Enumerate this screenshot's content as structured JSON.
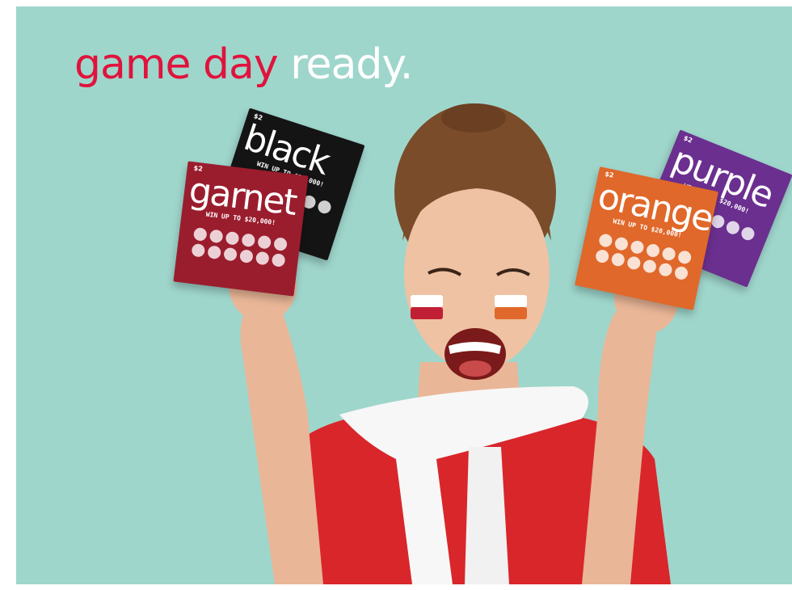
{
  "headline": {
    "part1": "game day",
    "part2": "ready."
  },
  "tickets": [
    {
      "word": "black",
      "price": "$2",
      "win": "WIN UP TO $20,000!",
      "color": "#141414"
    },
    {
      "word": "garnet",
      "price": "$2",
      "win": "WIN UP TO $20,000!",
      "color": "#9a1d2e"
    },
    {
      "word": "purple",
      "price": "$2",
      "win": "WIN UP TO $20,000!",
      "color": "#6b2f8f"
    },
    {
      "word": "orange",
      "price": "$2",
      "win": "WIN UP TO $20,000!",
      "color": "#e0682a"
    }
  ],
  "colors": {
    "background": "#9fd6cc",
    "headline_red": "#e0133c",
    "headline_white": "#ffffff"
  }
}
